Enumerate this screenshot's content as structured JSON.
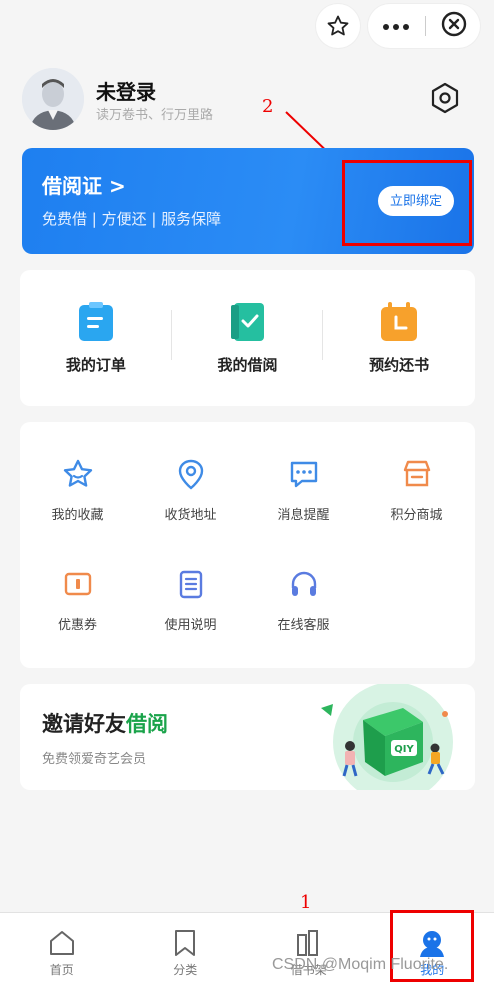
{
  "profile": {
    "name": "未登录",
    "motto": "读万卷书、行万里路"
  },
  "library_card": {
    "title": "借阅证 >",
    "subtitle": "免费借 | 方便还 | 服务保障",
    "bind_button": "立即绑定"
  },
  "orders": [
    {
      "label": "我的订单",
      "icon": "order-icon"
    },
    {
      "label": "我的借阅",
      "icon": "borrow-icon"
    },
    {
      "label": "预约还书",
      "icon": "return-icon"
    }
  ],
  "services": [
    {
      "label": "我的收藏",
      "icon": "star-icon"
    },
    {
      "label": "收货地址",
      "icon": "location-icon"
    },
    {
      "label": "消息提醒",
      "icon": "message-icon"
    },
    {
      "label": "积分商城",
      "icon": "store-icon"
    },
    {
      "label": "优惠券",
      "icon": "coupon-icon"
    },
    {
      "label": "使用说明",
      "icon": "document-icon"
    },
    {
      "label": "在线客服",
      "icon": "headset-icon"
    }
  ],
  "invite": {
    "title_prefix": "邀请好友",
    "title_highlight": "借阅",
    "subtitle": "免费领爱奇艺会员",
    "logo_text": "QIY"
  },
  "tabs": [
    {
      "label": "首页",
      "icon": "home-icon"
    },
    {
      "label": "分类",
      "icon": "bookmark-icon"
    },
    {
      "label": "借书架",
      "icon": "bookshelf-icon"
    },
    {
      "label": "我的",
      "icon": "user-icon"
    }
  ],
  "annotations": {
    "first": "1",
    "second": "2"
  },
  "watermark": "CSDN @Moqim Fluorite.",
  "colors": {
    "accent": "#1a73e8",
    "highlight_green": "#1aa34a",
    "annotation_red": "#e00000"
  }
}
